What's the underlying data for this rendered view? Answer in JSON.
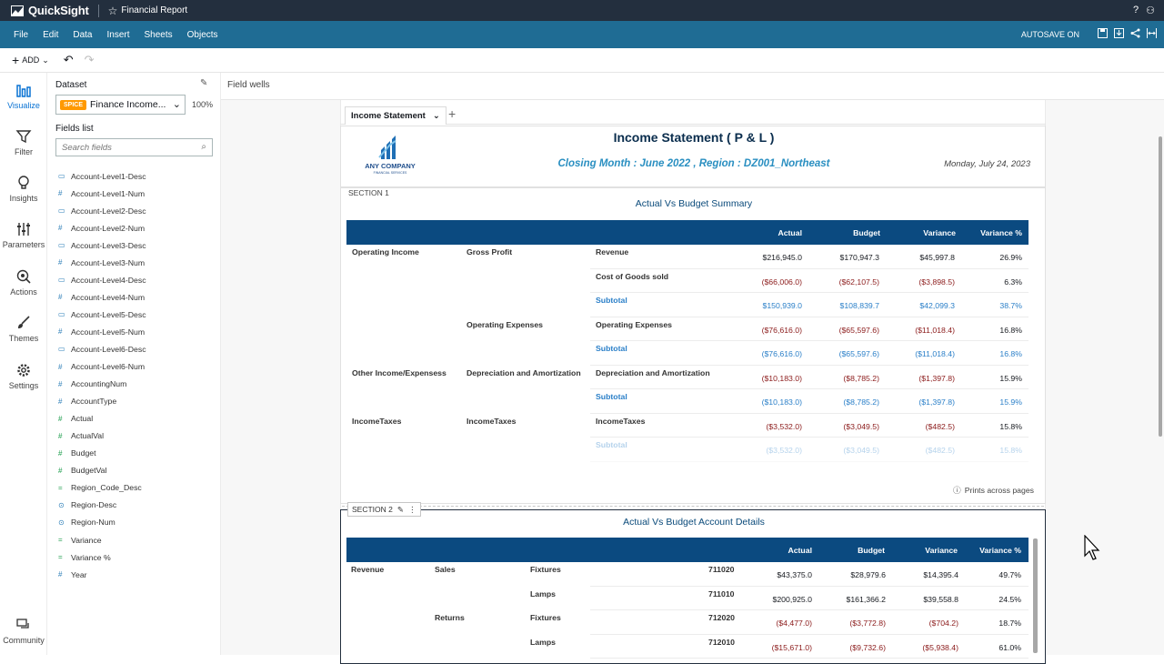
{
  "app": {
    "name": "QuickSight",
    "doc_title": "Financial Report"
  },
  "menu": [
    "File",
    "Edit",
    "Data",
    "Insert",
    "Sheets",
    "Objects"
  ],
  "autosave": "AUTOSAVE ON",
  "toolbar": {
    "add_label": "ADD"
  },
  "leftnav": [
    "Visualize",
    "Filter",
    "Insights",
    "Parameters",
    "Actions",
    "Themes",
    "Settings",
    "Community"
  ],
  "dataset": {
    "label": "Dataset",
    "badge": "SPICE",
    "name": "Finance Income...",
    "percent": "100%"
  },
  "fields_list": {
    "label": "Fields list",
    "search_placeholder": "Search fields"
  },
  "fields": [
    {
      "name": "Account-Level1-Desc",
      "type": "text"
    },
    {
      "name": "Account-Level1-Num",
      "type": "num"
    },
    {
      "name": "Account-Level2-Desc",
      "type": "text"
    },
    {
      "name": "Account-Level2-Num",
      "type": "num"
    },
    {
      "name": "Account-Level3-Desc",
      "type": "text"
    },
    {
      "name": "Account-Level3-Num",
      "type": "num"
    },
    {
      "name": "Account-Level4-Desc",
      "type": "text"
    },
    {
      "name": "Account-Level4-Num",
      "type": "num"
    },
    {
      "name": "Account-Level5-Desc",
      "type": "text"
    },
    {
      "name": "Account-Level5-Num",
      "type": "num"
    },
    {
      "name": "Account-Level6-Desc",
      "type": "text"
    },
    {
      "name": "Account-Level6-Num",
      "type": "num"
    },
    {
      "name": "AccountingNum",
      "type": "num"
    },
    {
      "name": "AccountType",
      "type": "num"
    },
    {
      "name": "Actual",
      "type": "measure"
    },
    {
      "name": "ActualVal",
      "type": "measure"
    },
    {
      "name": "Budget",
      "type": "measure"
    },
    {
      "name": "BudgetVal",
      "type": "measure"
    },
    {
      "name": "Region_Code_Desc",
      "type": "calc"
    },
    {
      "name": "Region-Desc",
      "type": "geo"
    },
    {
      "name": "Region-Num",
      "type": "geo"
    },
    {
      "name": "Variance",
      "type": "calc"
    },
    {
      "name": "Variance %",
      "type": "calc"
    },
    {
      "name": "Year",
      "type": "num"
    }
  ],
  "field_wells": "Field wells",
  "sheet_tab": "Income Statement",
  "report": {
    "title": "Income Statement ( P & L )",
    "subtitle": "Closing Month : June 2022  , Region : DZ001_Northeast",
    "date": "Monday, July 24, 2023",
    "logo_text": "ANY COMPANY",
    "logo_sub": "FINANCIAL SERVICES"
  },
  "section1": {
    "label": "SECTION 1",
    "title": "Actual Vs Budget Summary",
    "columns": [
      "Actual",
      "Budget",
      "Variance",
      "Variance %"
    ],
    "rows": [
      {
        "l1": "Operating Income",
        "l2": "Gross Profit",
        "l3": "Revenue",
        "actual": "$216,945.0",
        "budget": "$170,947.3",
        "variance": "$45,997.8",
        "pct": "26.9%",
        "kind": "normal"
      },
      {
        "l1": "",
        "l2": "",
        "l3": "Cost of Goods sold",
        "actual": "($66,006.0)",
        "budget": "($62,107.5)",
        "variance": "($3,898.5)",
        "pct": "6.3%",
        "kind": "neg"
      },
      {
        "l1": "",
        "l2": "",
        "l3": "Subtotal",
        "actual": "$150,939.0",
        "budget": "$108,839.7",
        "variance": "$42,099.3",
        "pct": "38.7%",
        "kind": "sub"
      },
      {
        "l1": "",
        "l2": "Operating Expenses",
        "l3": "Operating Expenses",
        "actual": "($76,616.0)",
        "budget": "($65,597.6)",
        "variance": "($11,018.4)",
        "pct": "16.8%",
        "kind": "neg"
      },
      {
        "l1": "",
        "l2": "",
        "l3": "Subtotal",
        "actual": "($76,616.0)",
        "budget": "($65,597.6)",
        "variance": "($11,018.4)",
        "pct": "16.8%",
        "kind": "sub"
      },
      {
        "l1": "Other Income/Expensess",
        "l2": "Depreciation and Amortization",
        "l3": "Depreciation and Amortization",
        "actual": "($10,183.0)",
        "budget": "($8,785.2)",
        "variance": "($1,397.8)",
        "pct": "15.9%",
        "kind": "neg"
      },
      {
        "l1": "",
        "l2": "",
        "l3": "Subtotal",
        "actual": "($10,183.0)",
        "budget": "($8,785.2)",
        "variance": "($1,397.8)",
        "pct": "15.9%",
        "kind": "sub"
      },
      {
        "l1": "IncomeTaxes",
        "l2": "IncomeTaxes",
        "l3": "IncomeTaxes",
        "actual": "($3,532.0)",
        "budget": "($3,049.5)",
        "variance": "($482.5)",
        "pct": "15.8%",
        "kind": "neg"
      },
      {
        "l1": "",
        "l2": "",
        "l3": "Subtotal",
        "actual": "($3,532.0)",
        "budget": "($3,049.5)",
        "variance": "($482.5)",
        "pct": "15.8%",
        "kind": "subfade"
      }
    ],
    "prints": "Prints across pages"
  },
  "section2": {
    "label": "SECTION 2",
    "title": "Actual Vs Budget Account Details",
    "columns": [
      "Actual",
      "Budget",
      "Variance",
      "Variance %"
    ],
    "rows": [
      {
        "l1": "Revenue",
        "l2": "Sales",
        "l3": "Fixtures",
        "acct": "711020",
        "actual": "$43,375.0",
        "budget": "$28,979.6",
        "variance": "$14,395.4",
        "pct": "49.7%",
        "kind": "normal"
      },
      {
        "l1": "",
        "l2": "",
        "l3": "Lamps",
        "acct": "711010",
        "actual": "$200,925.0",
        "budget": "$161,366.2",
        "variance": "$39,558.8",
        "pct": "24.5%",
        "kind": "normal"
      },
      {
        "l1": "",
        "l2": "Returns",
        "l3": "Fixtures",
        "acct": "712020",
        "actual": "($4,477.0)",
        "budget": "($3,772.8)",
        "variance": "($704.2)",
        "pct": "18.7%",
        "kind": "neg"
      },
      {
        "l1": "",
        "l2": "",
        "l3": "Lamps",
        "acct": "712010",
        "actual": "($15,671.0)",
        "budget": "($9,732.6)",
        "variance": "($5,938.4)",
        "pct": "61.0%",
        "kind": "neg"
      }
    ]
  },
  "colors": {
    "topbar": "#232f3e",
    "menubar": "#1f6c94",
    "table_header": "#0b4a80",
    "subtotal": "#2a7fc8",
    "negative": "#8b1a1a",
    "spice": "#ff9900"
  }
}
